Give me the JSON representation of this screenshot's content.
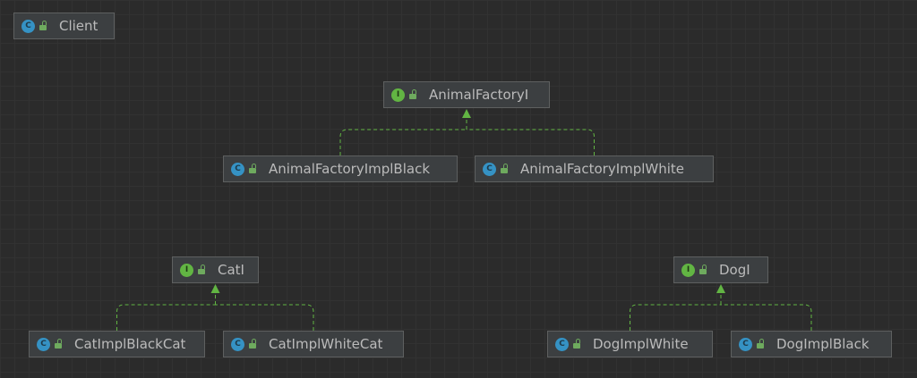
{
  "diagram": {
    "nodes": [
      {
        "id": "client",
        "kind": "class",
        "badge_letter": "C",
        "label": "Client"
      },
      {
        "id": "animal_factory_i",
        "kind": "interface",
        "badge_letter": "I",
        "label": "AnimalFactoryI"
      },
      {
        "id": "animal_factory_impl_black",
        "kind": "class",
        "badge_letter": "C",
        "label": "AnimalFactoryImplBlack"
      },
      {
        "id": "animal_factory_impl_white",
        "kind": "class",
        "badge_letter": "C",
        "label": "AnimalFactoryImplWhite"
      },
      {
        "id": "cat_i",
        "kind": "interface",
        "badge_letter": "I",
        "label": "CatI"
      },
      {
        "id": "dog_i",
        "kind": "interface",
        "badge_letter": "I",
        "label": "DogI"
      },
      {
        "id": "cat_impl_black_cat",
        "kind": "class",
        "badge_letter": "C",
        "label": "CatImplBlackCat"
      },
      {
        "id": "cat_impl_white_cat",
        "kind": "class",
        "badge_letter": "C",
        "label": "CatImplWhiteCat"
      },
      {
        "id": "dog_impl_white",
        "kind": "class",
        "badge_letter": "C",
        "label": "DogImplWhite"
      },
      {
        "id": "dog_impl_black",
        "kind": "class",
        "badge_letter": "C",
        "label": "DogImplBlack"
      }
    ],
    "edges": [
      {
        "from": "animal_factory_impl_black",
        "to": "animal_factory_i",
        "type": "implements"
      },
      {
        "from": "animal_factory_impl_white",
        "to": "animal_factory_i",
        "type": "implements"
      },
      {
        "from": "cat_impl_black_cat",
        "to": "cat_i",
        "type": "implements"
      },
      {
        "from": "cat_impl_white_cat",
        "to": "cat_i",
        "type": "implements"
      },
      {
        "from": "dog_impl_white",
        "to": "dog_i",
        "type": "implements"
      },
      {
        "from": "dog_impl_black",
        "to": "dog_i",
        "type": "implements"
      }
    ],
    "colors": {
      "background": "#2b2b2b",
      "node_fill": "#3c3f41",
      "node_border": "#5e6060",
      "text": "#bbbbbb",
      "class_badge": "#3592c4",
      "interface_badge": "#62b543",
      "edge": "#62b543"
    },
    "icons": {
      "class": "class-c-icon",
      "interface": "interface-i-icon",
      "visibility": "public-lock-icon"
    }
  }
}
